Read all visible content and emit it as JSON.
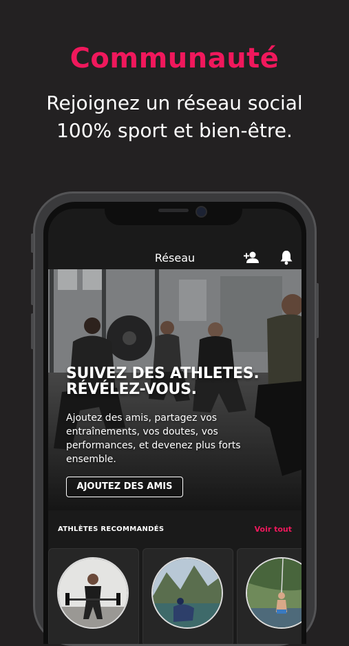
{
  "promo": {
    "title": "Communauté",
    "subtitle_line1": "Rejoignez un réseau social",
    "subtitle_line2": "100% sport et bien-être."
  },
  "nav": {
    "title": "Réseau",
    "add_friend_icon": "person-add-icon",
    "notifications_icon": "bell-icon"
  },
  "hero": {
    "headline_line1": "SUIVEZ DES ATHLETES.",
    "headline_line2": "RÉVÉLEZ-VOUS.",
    "body": "Ajoutez des amis, partagez vos entraînements, vos doutes, vos performances, et devenez plus forts ensemble.",
    "button_label": "AJOUTEZ DES AMIS"
  },
  "recommended": {
    "header": "ATHLÈTES RECOMMANDÉS",
    "see_all_label": "Voir tout"
  },
  "colors": {
    "accent": "#f0185c",
    "background": "#232122"
  }
}
